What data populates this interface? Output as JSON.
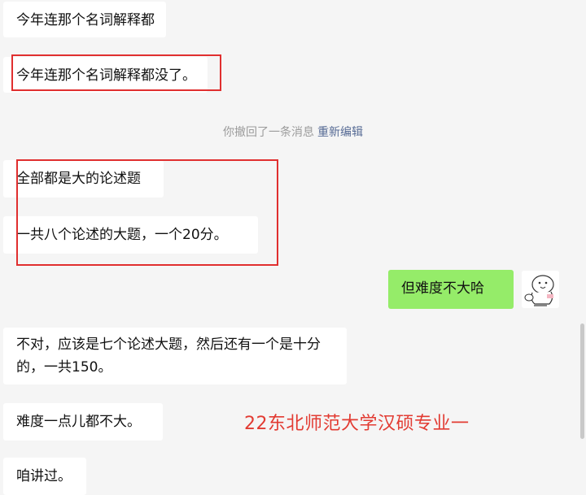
{
  "messages": [
    {
      "text": "今年连那个名词解释都"
    },
    {
      "text": "今年连那个名词解释都没了。"
    },
    {
      "text": "全部都是大的论述题"
    },
    {
      "text": "一共八个论述的大题，一个20分。"
    },
    {
      "text": "但难度不大哈"
    },
    {
      "text": "不对，应该是七个论述大题，然后还有一个是十分的，一共150。"
    },
    {
      "text": "难度一点儿都不大。"
    },
    {
      "text": "咱讲过。"
    }
  ],
  "system": {
    "recalled_text": "你撤回了一条消息",
    "reedit_label": "重新编辑"
  },
  "watermark": "22东北师范大学汉硕专业一",
  "colors": {
    "chat_background": "#f5f5f5",
    "incoming_bubble": "#ffffff",
    "outgoing_bubble": "#95ec69",
    "highlight_box": "#e02f2f",
    "watermark": "#e23b32",
    "link": "#576b95"
  }
}
